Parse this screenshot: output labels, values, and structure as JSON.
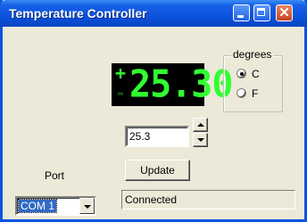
{
  "window": {
    "title": "Temperature Controller",
    "close_glyph": "✕"
  },
  "display": {
    "plus_sign": "+",
    "minus_sign": "-",
    "value": "25.30",
    "color": "#30ff30"
  },
  "degrees": {
    "label": "degrees",
    "options": [
      {
        "label": "C",
        "checked": true
      },
      {
        "label": "F",
        "checked": false
      }
    ]
  },
  "setpoint": {
    "value": "25.3"
  },
  "update_button": {
    "label": "Update"
  },
  "port": {
    "label": "Port",
    "selected": "COM 1"
  },
  "status": {
    "text": "Connected"
  },
  "colors": {
    "titlebar": "#0a54e3",
    "face": "#ece9d8",
    "selection": "#316ac5"
  }
}
